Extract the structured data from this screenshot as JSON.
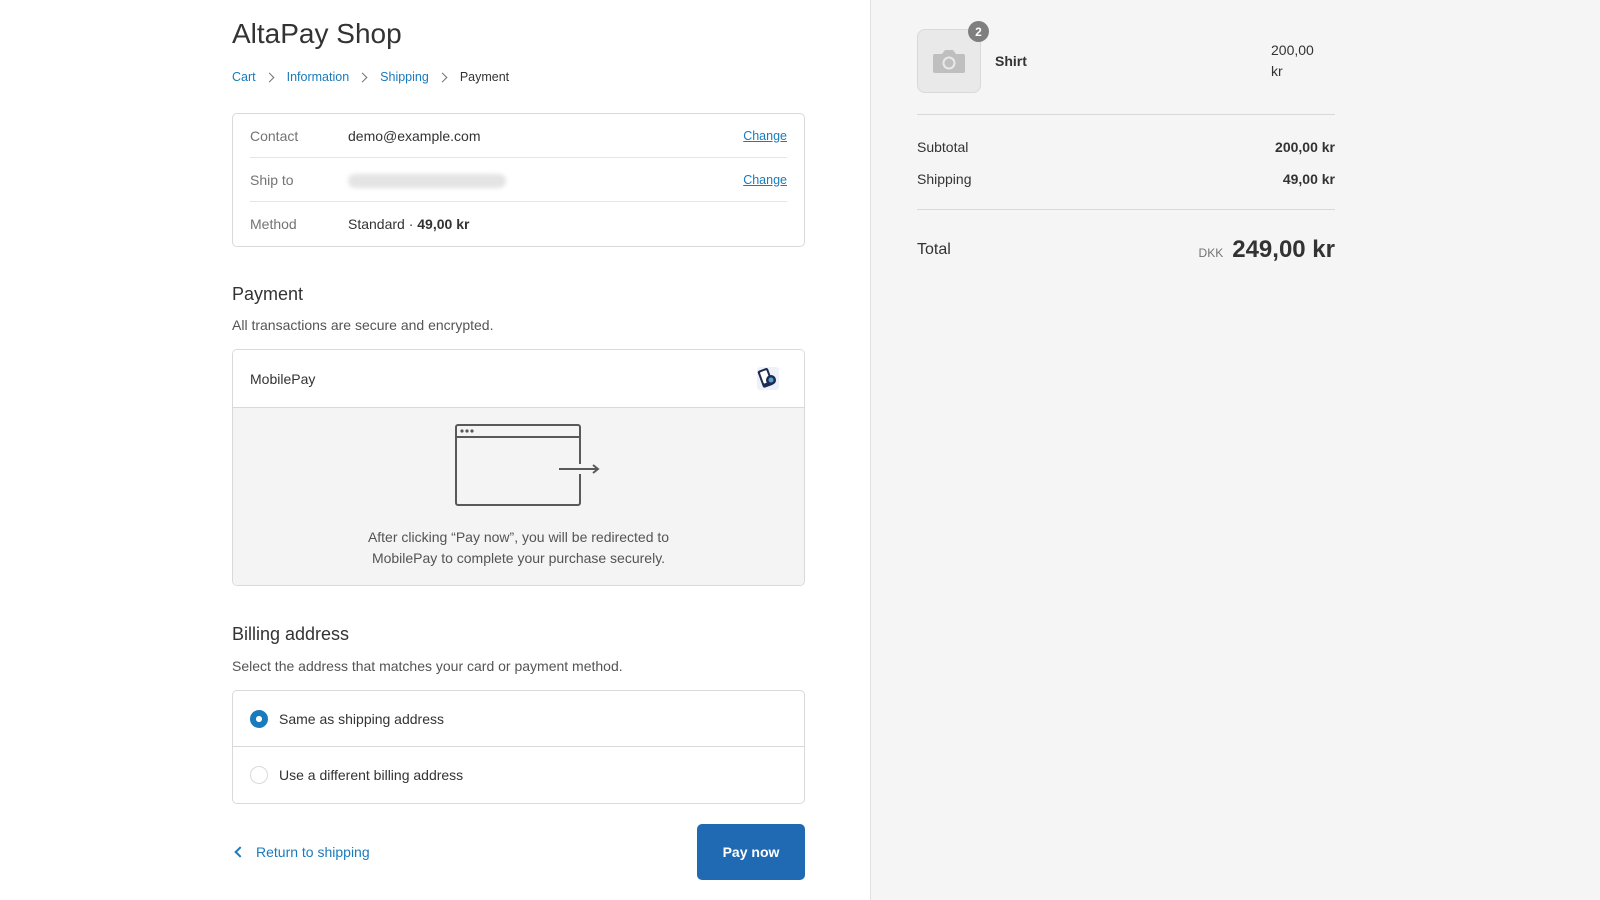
{
  "shop": {
    "title": "AltaPay Shop"
  },
  "breadcrumb": [
    "Cart",
    "Information",
    "Shipping",
    "Payment"
  ],
  "review": {
    "contact_label": "Contact",
    "contact_value": "demo@example.com",
    "ship_label": "Ship to",
    "method_label": "Method",
    "method_name": "Standard · ",
    "method_price": "49,00 kr",
    "change_label": "Change"
  },
  "payment": {
    "title": "Payment",
    "subtitle": "All transactions are secure and encrypted.",
    "method": "MobilePay",
    "redirect_text_1": "After clicking “Pay now”, you will be redirected to",
    "redirect_text_2": "MobilePay to complete your purchase securely."
  },
  "billing": {
    "title": "Billing address",
    "subtitle": "Select the address that matches your card or payment method.",
    "option_same": "Same as shipping address",
    "option_different": "Use a different billing address",
    "selected": "same"
  },
  "footer": {
    "return_label": "Return to shipping",
    "pay_label": "Pay now"
  },
  "summary": {
    "product_name": "Shirt",
    "product_qty": "2",
    "product_price_1": "200,00",
    "product_price_2": "kr",
    "subtotal_label": "Subtotal",
    "subtotal_value": "200,00 kr",
    "shipping_label": "Shipping",
    "shipping_value": "49,00 kr",
    "total_label": "Total",
    "currency": "DKK",
    "total_value": "249,00 kr"
  },
  "colors": {
    "accent": "#197bbd",
    "button": "#1f6ab2",
    "sidebar_bg": "#f5f5f5"
  },
  "icons": [
    "chevron-right-icon",
    "mobilepay-logo-icon",
    "browser-redirect-icon",
    "camera-icon",
    "chevron-left-icon"
  ]
}
